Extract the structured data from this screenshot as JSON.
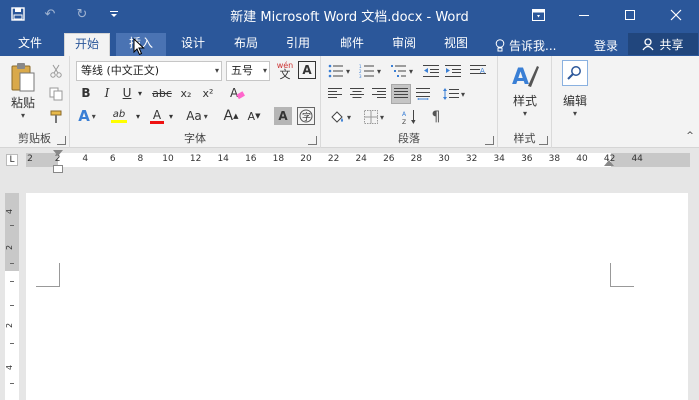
{
  "window": {
    "title": "新建 Microsoft Word 文档.docx - Word",
    "controls": [
      "restore-ribbon",
      "minimize",
      "maximize",
      "close"
    ]
  },
  "qat": {
    "icons": [
      "save-icon",
      "undo-icon",
      "redo-icon",
      "customize-qat-icon"
    ]
  },
  "tabs": [
    {
      "label": "文件",
      "state": "normal"
    },
    {
      "label": "开始",
      "state": "active"
    },
    {
      "label": "插入",
      "state": "hover"
    },
    {
      "label": "设计",
      "state": "normal"
    },
    {
      "label": "布局",
      "state": "normal"
    },
    {
      "label": "引用",
      "state": "normal"
    },
    {
      "label": "邮件",
      "state": "normal"
    },
    {
      "label": "审阅",
      "state": "normal"
    },
    {
      "label": "视图",
      "state": "normal"
    }
  ],
  "tell_me": "告诉我...",
  "signin": "登录",
  "share": "共享",
  "ribbon": {
    "clipboard": {
      "label": "剪贴板",
      "paste": "粘贴"
    },
    "font": {
      "label": "字体",
      "font_name": "等线 (中文正文)",
      "font_size": "五号",
      "phonetic": "wén",
      "bold": "B",
      "italic": "I",
      "underline": "U",
      "strike": "abc",
      "subscript": "x₂",
      "superscript": "x²",
      "grow": "A",
      "shrink": "A",
      "change_case": "Aa",
      "highlight": "ab",
      "font_color": "A",
      "shading": "A",
      "border": "A"
    },
    "paragraph": {
      "label": "段落"
    },
    "styles": {
      "label": "样式",
      "styles_btn": "样式"
    },
    "editing": {
      "edit_btn": "编辑"
    }
  },
  "ruler": {
    "tab_selector": "L",
    "h_numbers": [
      "2",
      "2",
      "4",
      "6",
      "8",
      "10",
      "12",
      "14",
      "16",
      "18",
      "20",
      "22",
      "24",
      "26",
      "28",
      "30",
      "32",
      "34",
      "36",
      "38",
      "40",
      "42",
      "44"
    ],
    "v_numbers": [
      "4",
      "2",
      "2",
      "4"
    ]
  },
  "colors": {
    "brand": "#2b579a",
    "ribbon_bg": "#f3f3f3",
    "highlight_yellow": "#ffff00",
    "font_red": "#e11"
  }
}
